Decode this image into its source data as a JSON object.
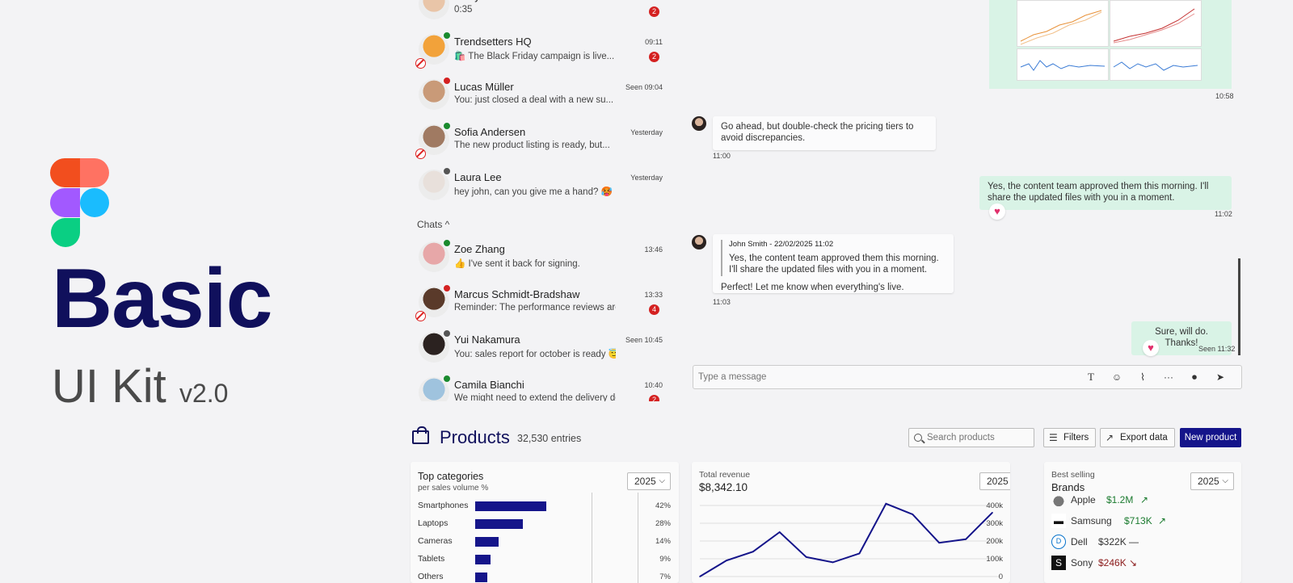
{
  "brand": {
    "title": "Basic",
    "subtitle": "UI Kit",
    "version": "v2.0"
  },
  "chat_list": {
    "items": [
      {
        "name": "Emily Johnson",
        "preview": "0:35",
        "time": "",
        "unread": "2",
        "status": "",
        "muted": false,
        "avatar_color": "#e9c5a8"
      },
      {
        "name": "Trendsetters HQ",
        "preview": "🛍️ The Black Friday campaign is live...",
        "time": "09:11",
        "unread": "2",
        "status": "#1a8a2e",
        "muted": true,
        "avatar_color": "#f2a23a"
      },
      {
        "name": "Lucas Müller",
        "preview": "You: just closed a deal with a new su...",
        "time": "Seen 09:04",
        "unread": "",
        "status": "#d42121",
        "muted": false,
        "avatar_color": "#c99a78"
      },
      {
        "name": "Sofia Andersen",
        "preview": "The new product listing is ready, but...",
        "time": "Yesterday",
        "unread": "",
        "status": "#1a8a2e",
        "muted": true,
        "avatar_color": "#a07a62"
      },
      {
        "name": "Laura Lee",
        "preview": "hey john, can you give me a hand? 🥵",
        "time": "Yesterday",
        "unread": "",
        "status": "#555555",
        "muted": false,
        "avatar_color": "#e8e0db"
      }
    ],
    "section_label": "Chats ^",
    "chats": [
      {
        "name": "Zoe Zhang",
        "preview": "👍 I've sent it back for signing.",
        "time": "13:46",
        "unread": "",
        "status": "#1a8a2e",
        "muted": false,
        "avatar_color": "#e7a7a8"
      },
      {
        "name": "Marcus Schmidt-Bradshaw",
        "preview": "Reminder: The performance reviews are due...",
        "time": "13:33",
        "unread": "4",
        "status": "#d42121",
        "muted": true,
        "avatar_color": "#5a3a2a"
      },
      {
        "name": "Yui Nakamura",
        "preview": "You: sales report for october is ready 😇",
        "time": "Seen 10:45",
        "unread": "",
        "status": "#555555",
        "muted": false,
        "avatar_color": "#2b2220"
      },
      {
        "name": "Camila Bianchi",
        "preview": "We might need to extend the delivery deadli...",
        "time": "10:40",
        "unread": "2",
        "status": "#1a8a2e",
        "muted": false,
        "avatar_color": "#9fc3de"
      }
    ]
  },
  "conversation": {
    "image_time": "10:58",
    "messages": [
      {
        "text": "Go ahead, but double-check the pricing tiers to avoid discrepancies.",
        "time": "11:00"
      },
      {
        "text": "Yes, the content team approved them this morning. I'll share the updated files with you in a moment.",
        "time": "11:02"
      },
      {
        "quote_author": "John Smith - 22/02/2025 11:02",
        "quote_text": "Yes, the content team approved them this morning. I'll share the updated files with you in a moment.",
        "text": "Perfect! Let me know when everything's live.",
        "time": "11:03"
      },
      {
        "text": "Sure, will do. Thanks!",
        "time": "Seen 11:32"
      }
    ],
    "composer_placeholder": "Type a message",
    "icons": [
      "text-format-icon",
      "emoji-icon",
      "attach-icon",
      "more-icon",
      "mic-icon",
      "send-icon"
    ]
  },
  "products": {
    "title": "Products",
    "count": "32,530 entries",
    "search_placeholder": "Search products",
    "filters_label": "Filters",
    "export_label": "Export data",
    "new_label": "New product",
    "top_categories": {
      "title": "Top categories",
      "subtitle": "per sales volume %",
      "year": "2025",
      "rows": [
        {
          "label": "Smartphones",
          "value": 42,
          "pct": "42%"
        },
        {
          "label": "Laptops",
          "value": 28,
          "pct": "28%"
        },
        {
          "label": "Cameras",
          "value": 14,
          "pct": "14%"
        },
        {
          "label": "Tablets",
          "value": 9,
          "pct": "9%"
        },
        {
          "label": "Others",
          "value": 7,
          "pct": "7%"
        }
      ]
    },
    "revenue": {
      "title": "Total revenue",
      "value": "$8,342.10",
      "year": "2025",
      "y_ticks": [
        "400k",
        "300k",
        "200k",
        "100k",
        "0"
      ]
    },
    "best_selling": {
      "title": "Best selling",
      "subtitle": "Brands",
      "year": "2025",
      "brands": [
        {
          "name": "Apple",
          "value": "$1.2M",
          "trend": "↗",
          "color": "#1a7a2e"
        },
        {
          "name": "Samsung",
          "value": "$713K",
          "trend": "↗",
          "color": "#1a7a2e"
        },
        {
          "name": "Dell",
          "value": "$322K",
          "trend": "—",
          "color": "#333333"
        },
        {
          "name": "Sony",
          "value": "$246K",
          "trend": "↘",
          "color": "#8a1a1a"
        }
      ]
    }
  },
  "chart_data": {
    "type": "line",
    "title": "Total revenue",
    "x": [
      0,
      1,
      2,
      3,
      4,
      5,
      6,
      7,
      8,
      9,
      10,
      11
    ],
    "series": [
      {
        "values": [
          0,
          90000,
          140000,
          250000,
          110000,
          80000,
          130000,
          410000,
          350000,
          190000,
          210000,
          360000
        ]
      }
    ],
    "ylim": [
      0,
      400000
    ],
    "y_ticks": [
      "0",
      "100k",
      "200k",
      "300k",
      "400k"
    ]
  }
}
